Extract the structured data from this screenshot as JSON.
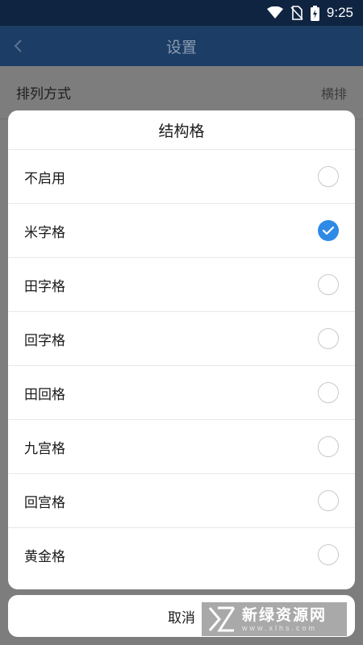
{
  "status_bar": {
    "time": "9:25",
    "icons": [
      "wifi-icon",
      "no-sim-icon",
      "battery-charging-icon"
    ]
  },
  "header": {
    "title": "设置",
    "back_icon": "chevron-left-icon"
  },
  "settings": {
    "rows": [
      {
        "label": "排列方式",
        "value": "横排"
      }
    ]
  },
  "dialog": {
    "title": "结构格",
    "options": [
      {
        "label": "不启用",
        "checked": false
      },
      {
        "label": "米字格",
        "checked": true
      },
      {
        "label": "田字格",
        "checked": false
      },
      {
        "label": "回字格",
        "checked": false
      },
      {
        "label": "田回格",
        "checked": false
      },
      {
        "label": "九宫格",
        "checked": false
      },
      {
        "label": "回宫格",
        "checked": false
      },
      {
        "label": "黄金格",
        "checked": false
      }
    ],
    "cancel_label": "取消"
  },
  "watermark": {
    "text": "新绿资源网",
    "sub": "www.xlhs.com"
  },
  "colors": {
    "accent": "#2f8ae6",
    "header": "#1c3d66",
    "status_bar": "#0f2440"
  }
}
